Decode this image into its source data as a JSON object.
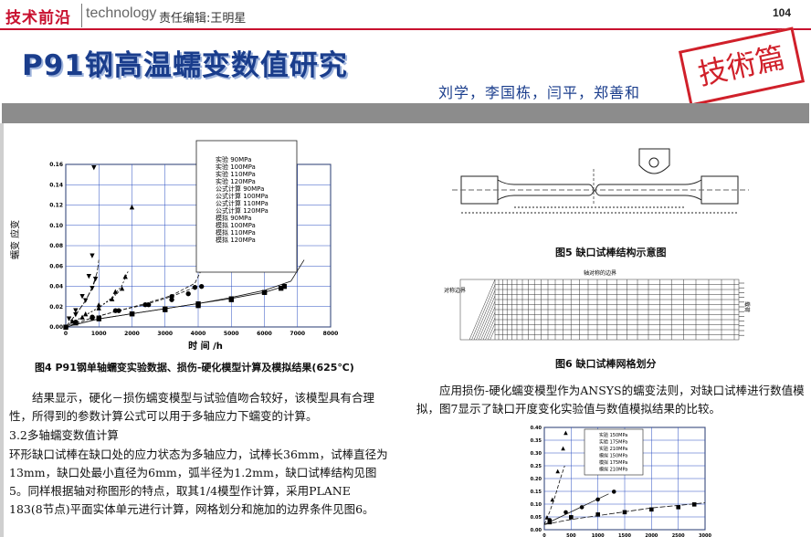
{
  "header": {
    "brand": "技术前沿",
    "brand_en": "technology",
    "editor": "责任编辑:王明星",
    "page_number": "104"
  },
  "article": {
    "title": "P91钢高温蠕变数值研究",
    "authors": "刘学，李国栋，闫平，郑善和",
    "stamp": "技術篇"
  },
  "fig4": {
    "caption": "图4 P91钢单轴蠕变实验数据、损伤-硬化模型计算及模拟结果(625℃)",
    "ylabel": "蠕变 应变",
    "xlabel": "时 间 /h",
    "legend": [
      "实验 90MPa",
      "实验 100MPa",
      "实验 110MPa",
      "实验 120MPa",
      "公式计算 90MPa",
      "公式计算 100MPa",
      "公式计算 110MPa",
      "公式计算 120MPa",
      "模拟 90MPa",
      "模拟 100MPa",
      "模拟 110MPa",
      "模拟 120MPa"
    ]
  },
  "fig5": {
    "caption": "图5 缺口试棒结构示意图"
  },
  "fig6": {
    "caption": "图6 缺口试棒网格划分",
    "label_top": "轴对称的边界",
    "label_right": "载荷",
    "label_left": "对称边界"
  },
  "fig7": {
    "legend": [
      "实验 150MPa",
      "实验 175MPa",
      "实验 210MPa",
      "模拟 150MPa",
      "模拟 175MPa",
      "模拟 210MPa"
    ]
  },
  "text": {
    "p1": "结果显示，硬化－损伤蠕变模型与试验值吻合较好，该模型具有合理性，所得到的参数计算公式可以用于多轴应力下蠕变的计算。",
    "h32": "3.2多轴蠕变数值计算",
    "p2a": "环形缺口试棒在缺口处的应力状态为多轴应力，试棒长36mm，试棒直径为13mm，缺口处最小直径为6mm，弧半径为1.2mm，缺口试棒结构见图5。同样根据轴对称图形的特点，取其1/4模型作计算，采用PLANE",
    "p2b": "183(8节点)平面实体单元进行计算，网格划分和施加的边界条件见图6。",
    "p3": "应用损伤-硬化蠕变模型作为ANSYS的蠕变法则，对缺口试棒进行数值模拟，图7显示了缺口开度变化实验值与数值模拟结果的比较。"
  },
  "chart_data": [
    {
      "type": "line",
      "title": "",
      "xlabel": "时 间 /h",
      "ylabel": "蠕变 应变",
      "xlim": [
        0,
        8000
      ],
      "ylim": [
        0,
        0.16
      ],
      "xticks": [
        0,
        1000,
        2000,
        3000,
        4000,
        5000,
        6000,
        7000,
        8000
      ],
      "yticks": [
        0.0,
        0.02,
        0.04,
        0.06,
        0.08,
        0.1,
        0.12,
        0.14,
        0.16
      ],
      "grid": true,
      "legend_position": "top-center",
      "series": [
        {
          "name": "实验 90MPa",
          "x": [
            300,
            1000,
            2000,
            3000,
            4000,
            5000,
            6000,
            6500
          ],
          "y": [
            0.004,
            0.009,
            0.013,
            0.017,
            0.021,
            0.027,
            0.034,
            0.038
          ]
        },
        {
          "name": "实验 100MPa",
          "x": [
            300,
            800,
            1500,
            2500,
            3200,
            3700,
            4100
          ],
          "y": [
            0.005,
            0.01,
            0.016,
            0.022,
            0.027,
            0.033,
            0.04
          ]
        },
        {
          "name": "实验 110MPa",
          "x": [
            200,
            600,
            1000,
            1500,
            1800,
            2000
          ],
          "y": [
            0.006,
            0.013,
            0.022,
            0.035,
            0.05,
            0.118
          ]
        },
        {
          "name": "实验 120MPa",
          "x": [
            100,
            300,
            500,
            700,
            800,
            850
          ],
          "y": [
            0.008,
            0.016,
            0.03,
            0.05,
            0.07,
            0.157
          ]
        },
        {
          "name": "公式计算 90MPa",
          "x": [
            0,
            1000,
            2000,
            3000,
            4000,
            5000,
            6000,
            6800,
            7200
          ],
          "y": [
            0,
            0.008,
            0.013,
            0.018,
            0.023,
            0.029,
            0.036,
            0.045,
            0.066
          ]
        },
        {
          "name": "公式计算 100MPa",
          "x": [
            0,
            800,
            1600,
            2400,
            3200,
            3900,
            4200
          ],
          "y": [
            0,
            0.009,
            0.016,
            0.023,
            0.031,
            0.043,
            0.063
          ]
        },
        {
          "name": "公式计算 110MPa",
          "x": [
            0,
            500,
            1000,
            1400,
            1700,
            1900
          ],
          "y": [
            0,
            0.01,
            0.019,
            0.029,
            0.041,
            0.056
          ]
        },
        {
          "name": "公式计算 120MPa",
          "x": [
            0,
            300,
            600,
            800,
            950,
            1000
          ],
          "y": [
            0,
            0.012,
            0.026,
            0.039,
            0.054,
            0.066
          ]
        },
        {
          "name": "模拟 90MPa",
          "x": [
            0,
            1000,
            2000,
            3000,
            4000,
            5000,
            6000,
            6600
          ],
          "y": [
            0,
            0.008,
            0.013,
            0.018,
            0.023,
            0.028,
            0.034,
            0.04
          ]
        },
        {
          "name": "模拟 100MPa",
          "x": [
            0,
            800,
            1600,
            2400,
            3200,
            3900
          ],
          "y": [
            0,
            0.009,
            0.016,
            0.022,
            0.03,
            0.039
          ]
        },
        {
          "name": "模拟 110MPa",
          "x": [
            0,
            500,
            1000,
            1400,
            1700
          ],
          "y": [
            0,
            0.01,
            0.019,
            0.028,
            0.038
          ]
        },
        {
          "name": "模拟 120MPa",
          "x": [
            0,
            300,
            600,
            800,
            900
          ],
          "y": [
            0,
            0.012,
            0.026,
            0.038,
            0.047
          ]
        }
      ]
    },
    {
      "type": "line",
      "title": "",
      "xlim": [
        0,
        3000
      ],
      "ylim": [
        0,
        0.4
      ],
      "xticks": [
        0,
        500,
        1000,
        1500,
        2000,
        2500,
        3000
      ],
      "yticks": [
        0.0,
        0.05,
        0.1,
        0.15,
        0.2,
        0.25,
        0.3,
        0.35,
        0.4
      ],
      "grid": true,
      "legend_position": "top-center",
      "series": [
        {
          "name": "实验 150MPa",
          "x": [
            100,
            500,
            1000,
            1500,
            2000,
            2500,
            2800
          ],
          "y": [
            0.03,
            0.05,
            0.06,
            0.07,
            0.08,
            0.09,
            0.1
          ]
        },
        {
          "name": "实验 175MPa",
          "x": [
            100,
            400,
            700,
            1000,
            1300
          ],
          "y": [
            0.04,
            0.07,
            0.09,
            0.12,
            0.15
          ]
        },
        {
          "name": "实验 210MPa",
          "x": [
            50,
            150,
            250,
            350,
            400
          ],
          "y": [
            0.05,
            0.12,
            0.23,
            0.32,
            0.38
          ]
        },
        {
          "name": "模拟 150MPa",
          "x": [
            0,
            500,
            1000,
            1500,
            2000,
            2500,
            3000
          ],
          "y": [
            0.02,
            0.04,
            0.055,
            0.07,
            0.085,
            0.095,
            0.105
          ]
        },
        {
          "name": "模拟 175MPa",
          "x": [
            0,
            300,
            600,
            900,
            1200
          ],
          "y": [
            0.02,
            0.05,
            0.08,
            0.11,
            0.14
          ]
        },
        {
          "name": "模拟 210MPa",
          "x": [
            0,
            100,
            200,
            300,
            380
          ],
          "y": [
            0.02,
            0.07,
            0.13,
            0.2,
            0.25
          ]
        }
      ]
    }
  ]
}
